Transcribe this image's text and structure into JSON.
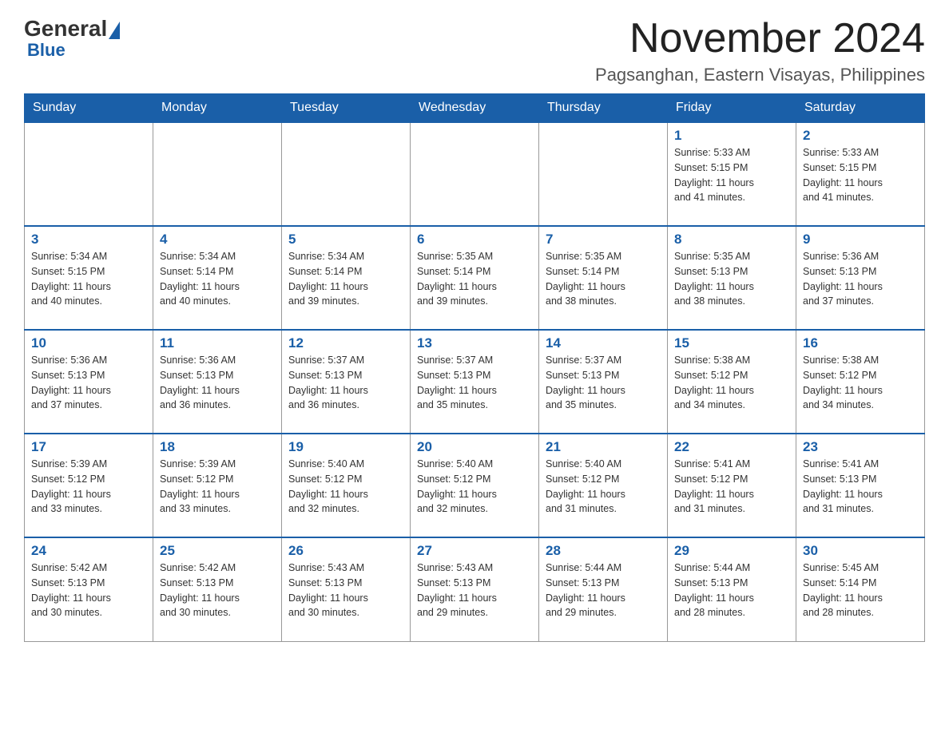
{
  "header": {
    "logo": {
      "general": "General",
      "blue": "Blue"
    },
    "title": "November 2024",
    "location": "Pagsanghan, Eastern Visayas, Philippines"
  },
  "days_of_week": [
    "Sunday",
    "Monday",
    "Tuesday",
    "Wednesday",
    "Thursday",
    "Friday",
    "Saturday"
  ],
  "weeks": [
    [
      {
        "day": "",
        "info": ""
      },
      {
        "day": "",
        "info": ""
      },
      {
        "day": "",
        "info": ""
      },
      {
        "day": "",
        "info": ""
      },
      {
        "day": "",
        "info": ""
      },
      {
        "day": "1",
        "info": "Sunrise: 5:33 AM\nSunset: 5:15 PM\nDaylight: 11 hours\nand 41 minutes."
      },
      {
        "day": "2",
        "info": "Sunrise: 5:33 AM\nSunset: 5:15 PM\nDaylight: 11 hours\nand 41 minutes."
      }
    ],
    [
      {
        "day": "3",
        "info": "Sunrise: 5:34 AM\nSunset: 5:15 PM\nDaylight: 11 hours\nand 40 minutes."
      },
      {
        "day": "4",
        "info": "Sunrise: 5:34 AM\nSunset: 5:14 PM\nDaylight: 11 hours\nand 40 minutes."
      },
      {
        "day": "5",
        "info": "Sunrise: 5:34 AM\nSunset: 5:14 PM\nDaylight: 11 hours\nand 39 minutes."
      },
      {
        "day": "6",
        "info": "Sunrise: 5:35 AM\nSunset: 5:14 PM\nDaylight: 11 hours\nand 39 minutes."
      },
      {
        "day": "7",
        "info": "Sunrise: 5:35 AM\nSunset: 5:14 PM\nDaylight: 11 hours\nand 38 minutes."
      },
      {
        "day": "8",
        "info": "Sunrise: 5:35 AM\nSunset: 5:13 PM\nDaylight: 11 hours\nand 38 minutes."
      },
      {
        "day": "9",
        "info": "Sunrise: 5:36 AM\nSunset: 5:13 PM\nDaylight: 11 hours\nand 37 minutes."
      }
    ],
    [
      {
        "day": "10",
        "info": "Sunrise: 5:36 AM\nSunset: 5:13 PM\nDaylight: 11 hours\nand 37 minutes."
      },
      {
        "day": "11",
        "info": "Sunrise: 5:36 AM\nSunset: 5:13 PM\nDaylight: 11 hours\nand 36 minutes."
      },
      {
        "day": "12",
        "info": "Sunrise: 5:37 AM\nSunset: 5:13 PM\nDaylight: 11 hours\nand 36 minutes."
      },
      {
        "day": "13",
        "info": "Sunrise: 5:37 AM\nSunset: 5:13 PM\nDaylight: 11 hours\nand 35 minutes."
      },
      {
        "day": "14",
        "info": "Sunrise: 5:37 AM\nSunset: 5:13 PM\nDaylight: 11 hours\nand 35 minutes."
      },
      {
        "day": "15",
        "info": "Sunrise: 5:38 AM\nSunset: 5:12 PM\nDaylight: 11 hours\nand 34 minutes."
      },
      {
        "day": "16",
        "info": "Sunrise: 5:38 AM\nSunset: 5:12 PM\nDaylight: 11 hours\nand 34 minutes."
      }
    ],
    [
      {
        "day": "17",
        "info": "Sunrise: 5:39 AM\nSunset: 5:12 PM\nDaylight: 11 hours\nand 33 minutes."
      },
      {
        "day": "18",
        "info": "Sunrise: 5:39 AM\nSunset: 5:12 PM\nDaylight: 11 hours\nand 33 minutes."
      },
      {
        "day": "19",
        "info": "Sunrise: 5:40 AM\nSunset: 5:12 PM\nDaylight: 11 hours\nand 32 minutes."
      },
      {
        "day": "20",
        "info": "Sunrise: 5:40 AM\nSunset: 5:12 PM\nDaylight: 11 hours\nand 32 minutes."
      },
      {
        "day": "21",
        "info": "Sunrise: 5:40 AM\nSunset: 5:12 PM\nDaylight: 11 hours\nand 31 minutes."
      },
      {
        "day": "22",
        "info": "Sunrise: 5:41 AM\nSunset: 5:12 PM\nDaylight: 11 hours\nand 31 minutes."
      },
      {
        "day": "23",
        "info": "Sunrise: 5:41 AM\nSunset: 5:13 PM\nDaylight: 11 hours\nand 31 minutes."
      }
    ],
    [
      {
        "day": "24",
        "info": "Sunrise: 5:42 AM\nSunset: 5:13 PM\nDaylight: 11 hours\nand 30 minutes."
      },
      {
        "day": "25",
        "info": "Sunrise: 5:42 AM\nSunset: 5:13 PM\nDaylight: 11 hours\nand 30 minutes."
      },
      {
        "day": "26",
        "info": "Sunrise: 5:43 AM\nSunset: 5:13 PM\nDaylight: 11 hours\nand 30 minutes."
      },
      {
        "day": "27",
        "info": "Sunrise: 5:43 AM\nSunset: 5:13 PM\nDaylight: 11 hours\nand 29 minutes."
      },
      {
        "day": "28",
        "info": "Sunrise: 5:44 AM\nSunset: 5:13 PM\nDaylight: 11 hours\nand 29 minutes."
      },
      {
        "day": "29",
        "info": "Sunrise: 5:44 AM\nSunset: 5:13 PM\nDaylight: 11 hours\nand 28 minutes."
      },
      {
        "day": "30",
        "info": "Sunrise: 5:45 AM\nSunset: 5:14 PM\nDaylight: 11 hours\nand 28 minutes."
      }
    ]
  ]
}
